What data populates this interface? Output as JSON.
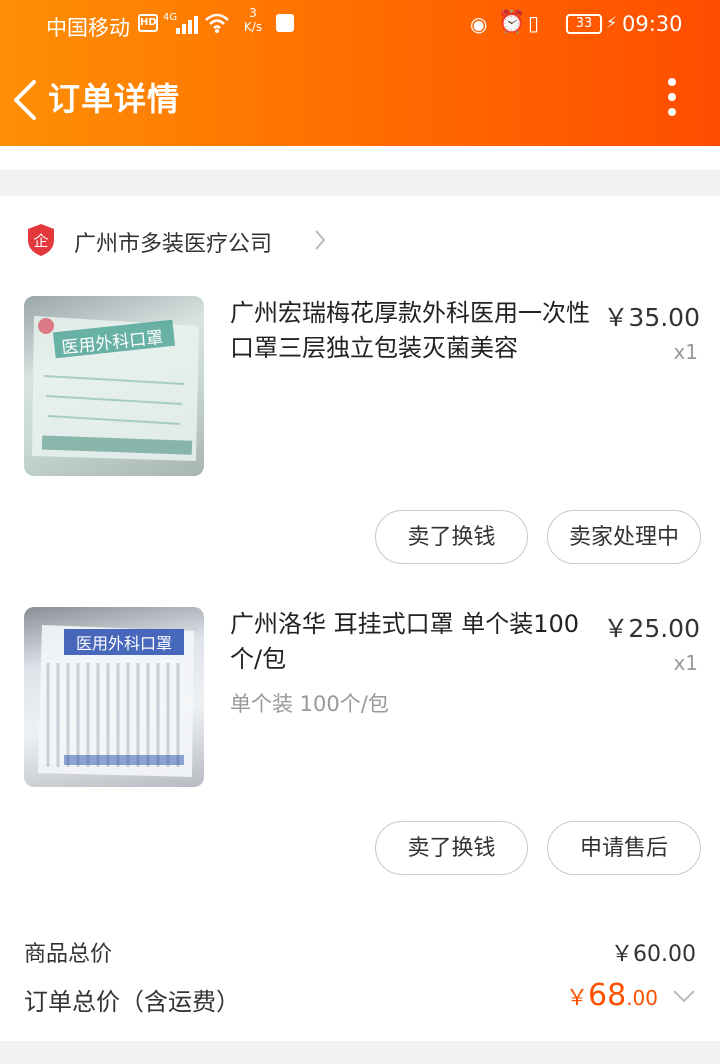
{
  "status_bar": {
    "carrier": "中国移动",
    "hd": "HD",
    "network": "4G",
    "speed_value": "3",
    "speed_unit": "K/s",
    "battery": "33",
    "time": "09:30"
  },
  "nav": {
    "title": "订单详情"
  },
  "shop": {
    "name": "广州市多装医疗公司",
    "badge_char": "企",
    "badge_color": "#e4393c"
  },
  "items": [
    {
      "title": "广州宏瑞梅花厚款外科医用一次性口罩三层独立包装灭菌美容",
      "price": "￥35.00",
      "qty": "x1",
      "spec": "",
      "thumb_text": "医用外科口罩",
      "actions": [
        "卖了换钱",
        "卖家处理中"
      ]
    },
    {
      "title": "广州洛华 耳挂式口罩 单个装100个/包",
      "price": "￥25.00",
      "qty": "x1",
      "spec": "单个装 100个/包",
      "thumb_text": "医用外科口罩",
      "actions": [
        "卖了换钱",
        "申请售后"
      ]
    }
  ],
  "summary": {
    "goods_total_label": "商品总价",
    "goods_total_value": "￥60.00",
    "order_total_label": "订单总价（含运费）",
    "order_total_currency": "￥",
    "order_total_int": "68",
    "order_total_dec": ".00"
  },
  "colors": {
    "header_start": "#fe8f05",
    "header_end": "#ff4d00",
    "accent": "#ff5000"
  }
}
